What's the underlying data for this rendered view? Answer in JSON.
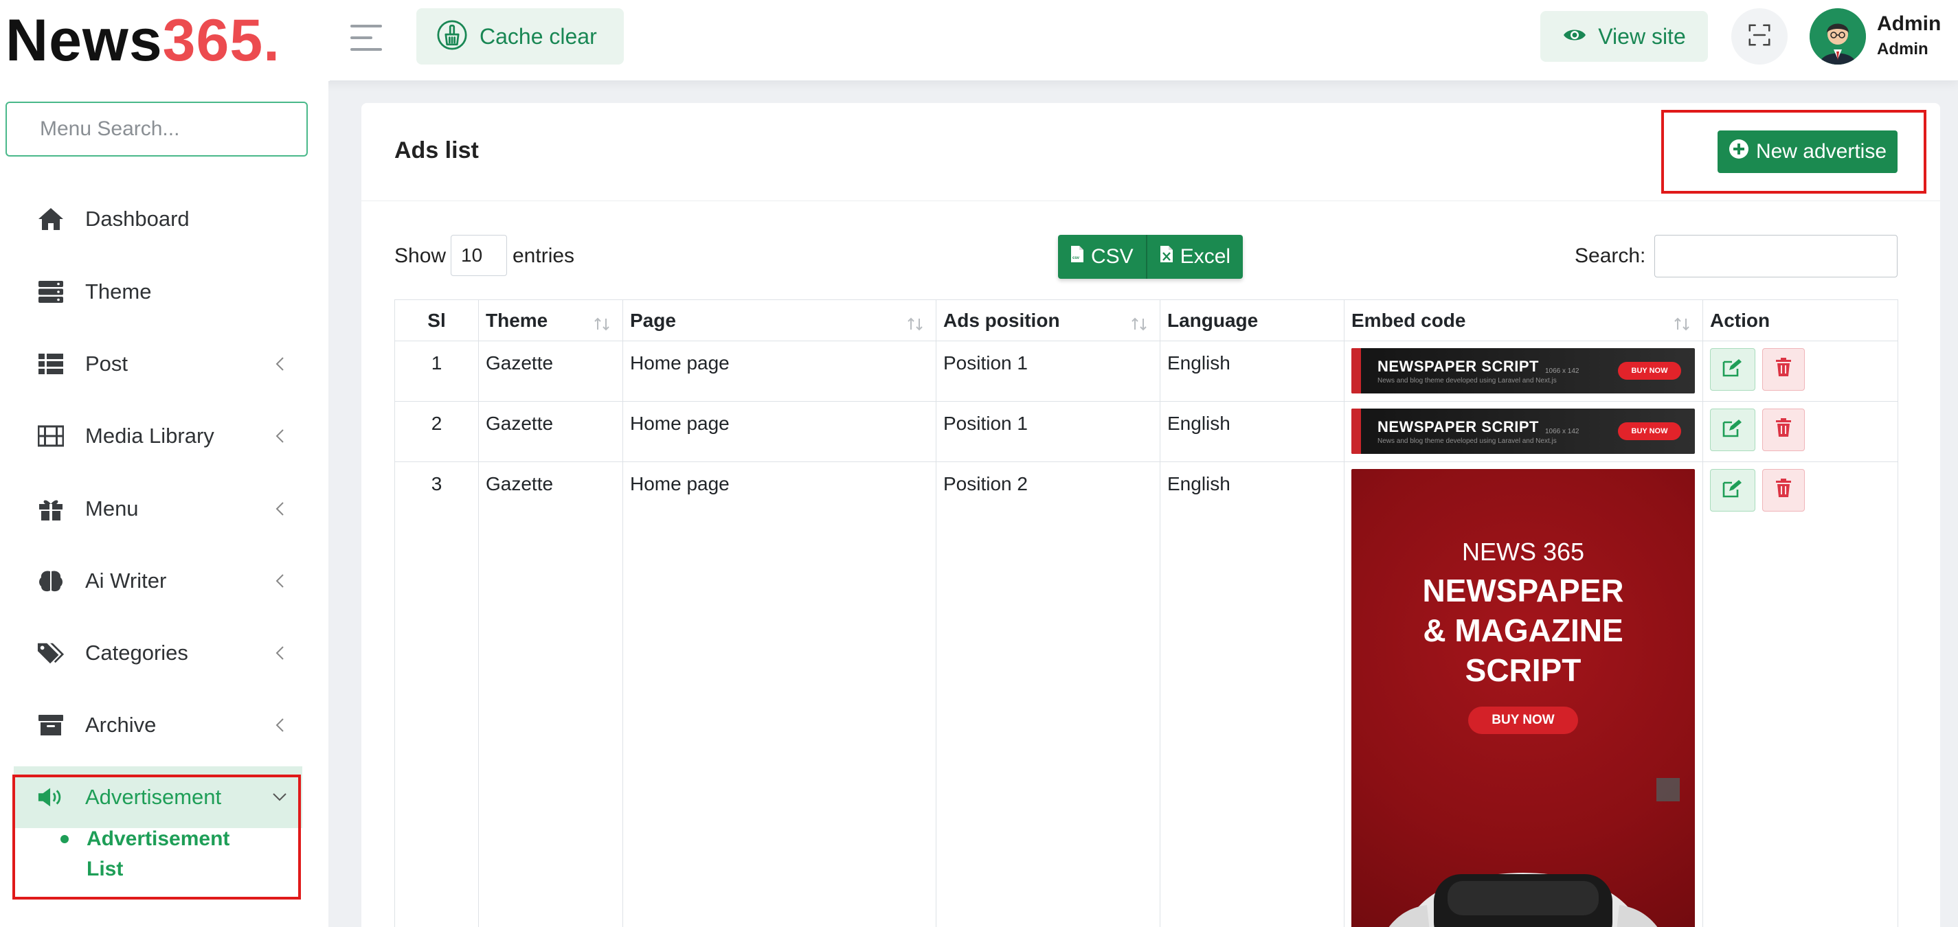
{
  "brand": {
    "logo_part1": "News",
    "logo_part2": "365."
  },
  "header": {
    "cache_clear_label": "Cache clear",
    "view_site_label": "View site",
    "user_name": "Admin",
    "user_role": "Admin"
  },
  "sidebar": {
    "search_placeholder": "Menu Search...",
    "items": [
      {
        "label": "Dashboard",
        "icon": "home-icon"
      },
      {
        "label": "Theme",
        "icon": "server-icon"
      },
      {
        "label": "Post",
        "icon": "list-icon"
      },
      {
        "label": "Media Library",
        "icon": "film-icon"
      },
      {
        "label": "Menu",
        "icon": "gift-icon"
      },
      {
        "label": "Ai Writer",
        "icon": "brain-icon"
      },
      {
        "label": "Categories",
        "icon": "tags-icon"
      },
      {
        "label": "Archive",
        "icon": "archive-icon"
      },
      {
        "label": "Advertisement",
        "icon": "megaphone-icon"
      }
    ],
    "sub_item_label": "Advertisement List"
  },
  "card": {
    "title": "Ads list",
    "new_button_label": "New advertise"
  },
  "table_controls": {
    "show_label": "Show",
    "page_size": "10",
    "entries_label": "entries",
    "csv_label": "CSV",
    "excel_label": "Excel",
    "search_label": "Search:"
  },
  "table": {
    "headers": [
      "Sl",
      "Theme",
      "Page",
      "Ads position",
      "Language",
      "Embed code",
      "Action"
    ],
    "rows": [
      {
        "sl": "1",
        "theme": "Gazette",
        "page": "Home page",
        "position": "Position 1",
        "language": "English",
        "embed": "banner"
      },
      {
        "sl": "2",
        "theme": "Gazette",
        "page": "Home page",
        "position": "Position 1",
        "language": "English",
        "embed": "banner"
      },
      {
        "sl": "3",
        "theme": "Gazette",
        "page": "Home page",
        "position": "Position 2",
        "language": "English",
        "embed": "poster"
      }
    ]
  },
  "ads": {
    "banner_title": "NEWSPAPER SCRIPT",
    "banner_subtitle": "News and blog theme developed using Laravel and Next.js",
    "banner_size": "1066 x 142",
    "banner_buy": "BUY NOW",
    "poster_brand": "NEWS 365",
    "poster_line1": "NEWSPAPER",
    "poster_line2": "& MAGAZINE",
    "poster_line3": "SCRIPT",
    "poster_buy": "BUY NOW"
  },
  "colors": {
    "primary_green": "#1b8a50",
    "accent_green": "#1e9e57",
    "logo_red": "#ec4b4f",
    "highlight_red": "#e01a1a"
  }
}
